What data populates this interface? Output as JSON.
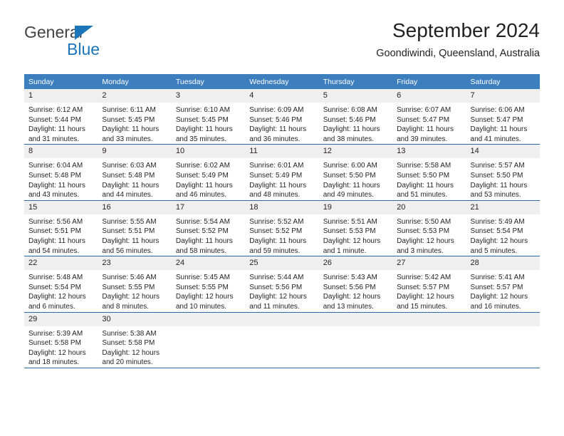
{
  "logo": {
    "general": "General",
    "blue": "Blue",
    "triangle_color": "#1b75bb"
  },
  "header": {
    "title": "September 2024",
    "subtitle": "Goondiwindi, Queensland, Australia"
  },
  "colors": {
    "header_blue": "#3d7ebe",
    "row_divider_blue": "#2b6ca8",
    "daynum_band": "#efefef",
    "text": "#231f20"
  },
  "weekdays": [
    "Sunday",
    "Monday",
    "Tuesday",
    "Wednesday",
    "Thursday",
    "Friday",
    "Saturday"
  ],
  "labels": {
    "sunrise_prefix": "Sunrise: ",
    "sunset_prefix": "Sunset: ",
    "daylight_prefix": "Daylight: "
  },
  "weeks": [
    [
      {
        "day": "1",
        "sunrise": "Sunrise: 6:12 AM",
        "sunset": "Sunset: 5:44 PM",
        "daylight": "Daylight: 11 hours and 31 minutes."
      },
      {
        "day": "2",
        "sunrise": "Sunrise: 6:11 AM",
        "sunset": "Sunset: 5:45 PM",
        "daylight": "Daylight: 11 hours and 33 minutes."
      },
      {
        "day": "3",
        "sunrise": "Sunrise: 6:10 AM",
        "sunset": "Sunset: 5:45 PM",
        "daylight": "Daylight: 11 hours and 35 minutes."
      },
      {
        "day": "4",
        "sunrise": "Sunrise: 6:09 AM",
        "sunset": "Sunset: 5:46 PM",
        "daylight": "Daylight: 11 hours and 36 minutes."
      },
      {
        "day": "5",
        "sunrise": "Sunrise: 6:08 AM",
        "sunset": "Sunset: 5:46 PM",
        "daylight": "Daylight: 11 hours and 38 minutes."
      },
      {
        "day": "6",
        "sunrise": "Sunrise: 6:07 AM",
        "sunset": "Sunset: 5:47 PM",
        "daylight": "Daylight: 11 hours and 39 minutes."
      },
      {
        "day": "7",
        "sunrise": "Sunrise: 6:06 AM",
        "sunset": "Sunset: 5:47 PM",
        "daylight": "Daylight: 11 hours and 41 minutes."
      }
    ],
    [
      {
        "day": "8",
        "sunrise": "Sunrise: 6:04 AM",
        "sunset": "Sunset: 5:48 PM",
        "daylight": "Daylight: 11 hours and 43 minutes."
      },
      {
        "day": "9",
        "sunrise": "Sunrise: 6:03 AM",
        "sunset": "Sunset: 5:48 PM",
        "daylight": "Daylight: 11 hours and 44 minutes."
      },
      {
        "day": "10",
        "sunrise": "Sunrise: 6:02 AM",
        "sunset": "Sunset: 5:49 PM",
        "daylight": "Daylight: 11 hours and 46 minutes."
      },
      {
        "day": "11",
        "sunrise": "Sunrise: 6:01 AM",
        "sunset": "Sunset: 5:49 PM",
        "daylight": "Daylight: 11 hours and 48 minutes."
      },
      {
        "day": "12",
        "sunrise": "Sunrise: 6:00 AM",
        "sunset": "Sunset: 5:50 PM",
        "daylight": "Daylight: 11 hours and 49 minutes."
      },
      {
        "day": "13",
        "sunrise": "Sunrise: 5:58 AM",
        "sunset": "Sunset: 5:50 PM",
        "daylight": "Daylight: 11 hours and 51 minutes."
      },
      {
        "day": "14",
        "sunrise": "Sunrise: 5:57 AM",
        "sunset": "Sunset: 5:50 PM",
        "daylight": "Daylight: 11 hours and 53 minutes."
      }
    ],
    [
      {
        "day": "15",
        "sunrise": "Sunrise: 5:56 AM",
        "sunset": "Sunset: 5:51 PM",
        "daylight": "Daylight: 11 hours and 54 minutes."
      },
      {
        "day": "16",
        "sunrise": "Sunrise: 5:55 AM",
        "sunset": "Sunset: 5:51 PM",
        "daylight": "Daylight: 11 hours and 56 minutes."
      },
      {
        "day": "17",
        "sunrise": "Sunrise: 5:54 AM",
        "sunset": "Sunset: 5:52 PM",
        "daylight": "Daylight: 11 hours and 58 minutes."
      },
      {
        "day": "18",
        "sunrise": "Sunrise: 5:52 AM",
        "sunset": "Sunset: 5:52 PM",
        "daylight": "Daylight: 11 hours and 59 minutes."
      },
      {
        "day": "19",
        "sunrise": "Sunrise: 5:51 AM",
        "sunset": "Sunset: 5:53 PM",
        "daylight": "Daylight: 12 hours and 1 minute."
      },
      {
        "day": "20",
        "sunrise": "Sunrise: 5:50 AM",
        "sunset": "Sunset: 5:53 PM",
        "daylight": "Daylight: 12 hours and 3 minutes."
      },
      {
        "day": "21",
        "sunrise": "Sunrise: 5:49 AM",
        "sunset": "Sunset: 5:54 PM",
        "daylight": "Daylight: 12 hours and 5 minutes."
      }
    ],
    [
      {
        "day": "22",
        "sunrise": "Sunrise: 5:48 AM",
        "sunset": "Sunset: 5:54 PM",
        "daylight": "Daylight: 12 hours and 6 minutes."
      },
      {
        "day": "23",
        "sunrise": "Sunrise: 5:46 AM",
        "sunset": "Sunset: 5:55 PM",
        "daylight": "Daylight: 12 hours and 8 minutes."
      },
      {
        "day": "24",
        "sunrise": "Sunrise: 5:45 AM",
        "sunset": "Sunset: 5:55 PM",
        "daylight": "Daylight: 12 hours and 10 minutes."
      },
      {
        "day": "25",
        "sunrise": "Sunrise: 5:44 AM",
        "sunset": "Sunset: 5:56 PM",
        "daylight": "Daylight: 12 hours and 11 minutes."
      },
      {
        "day": "26",
        "sunrise": "Sunrise: 5:43 AM",
        "sunset": "Sunset: 5:56 PM",
        "daylight": "Daylight: 12 hours and 13 minutes."
      },
      {
        "day": "27",
        "sunrise": "Sunrise: 5:42 AM",
        "sunset": "Sunset: 5:57 PM",
        "daylight": "Daylight: 12 hours and 15 minutes."
      },
      {
        "day": "28",
        "sunrise": "Sunrise: 5:41 AM",
        "sunset": "Sunset: 5:57 PM",
        "daylight": "Daylight: 12 hours and 16 minutes."
      }
    ],
    [
      {
        "day": "29",
        "sunrise": "Sunrise: 5:39 AM",
        "sunset": "Sunset: 5:58 PM",
        "daylight": "Daylight: 12 hours and 18 minutes."
      },
      {
        "day": "30",
        "sunrise": "Sunrise: 5:38 AM",
        "sunset": "Sunset: 5:58 PM",
        "daylight": "Daylight: 12 hours and 20 minutes."
      },
      {
        "day": "",
        "sunrise": "",
        "sunset": "",
        "daylight": ""
      },
      {
        "day": "",
        "sunrise": "",
        "sunset": "",
        "daylight": ""
      },
      {
        "day": "",
        "sunrise": "",
        "sunset": "",
        "daylight": ""
      },
      {
        "day": "",
        "sunrise": "",
        "sunset": "",
        "daylight": ""
      },
      {
        "day": "",
        "sunrise": "",
        "sunset": "",
        "daylight": ""
      }
    ]
  ]
}
